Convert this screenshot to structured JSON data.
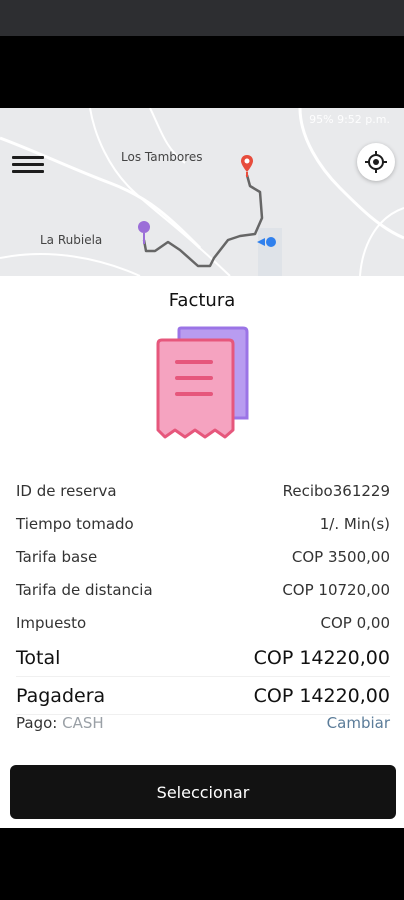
{
  "status_bar": {
    "text": "95%  9:52 p.m."
  },
  "map": {
    "places": {
      "los_tambores": "Los Tambores",
      "la_rubiela": "La Rubiela"
    }
  },
  "invoice": {
    "title": "Factura",
    "rows": [
      {
        "label": "ID de reserva",
        "value": "Recibo361229"
      },
      {
        "label": "Tiempo tomado",
        "value": "1/. Min(s)"
      },
      {
        "label": "Tarifa base",
        "value": "COP 3500,00"
      },
      {
        "label": "Tarifa de distancia",
        "value": "COP 10720,00"
      },
      {
        "label": "Impuesto",
        "value": "COP 0,00"
      }
    ],
    "total": {
      "label": "Total",
      "value": "COP 14220,00"
    },
    "payable": {
      "label": "Pagadera",
      "value": "COP 14220,00"
    },
    "payment": {
      "label": "Pago:",
      "method": "CASH",
      "change": "Cambiar"
    }
  },
  "actions": {
    "select": "Seleccionar"
  },
  "colors": {
    "accent": "#5b7c99",
    "button": "#121212",
    "receipt_front": "#f5a3c0",
    "receipt_back": "#b89cf0"
  },
  "icons": [
    "menu-icon",
    "locate-icon",
    "destination-pin-icon",
    "origin-pin-icon",
    "current-location-icon",
    "receipt-icon"
  ]
}
